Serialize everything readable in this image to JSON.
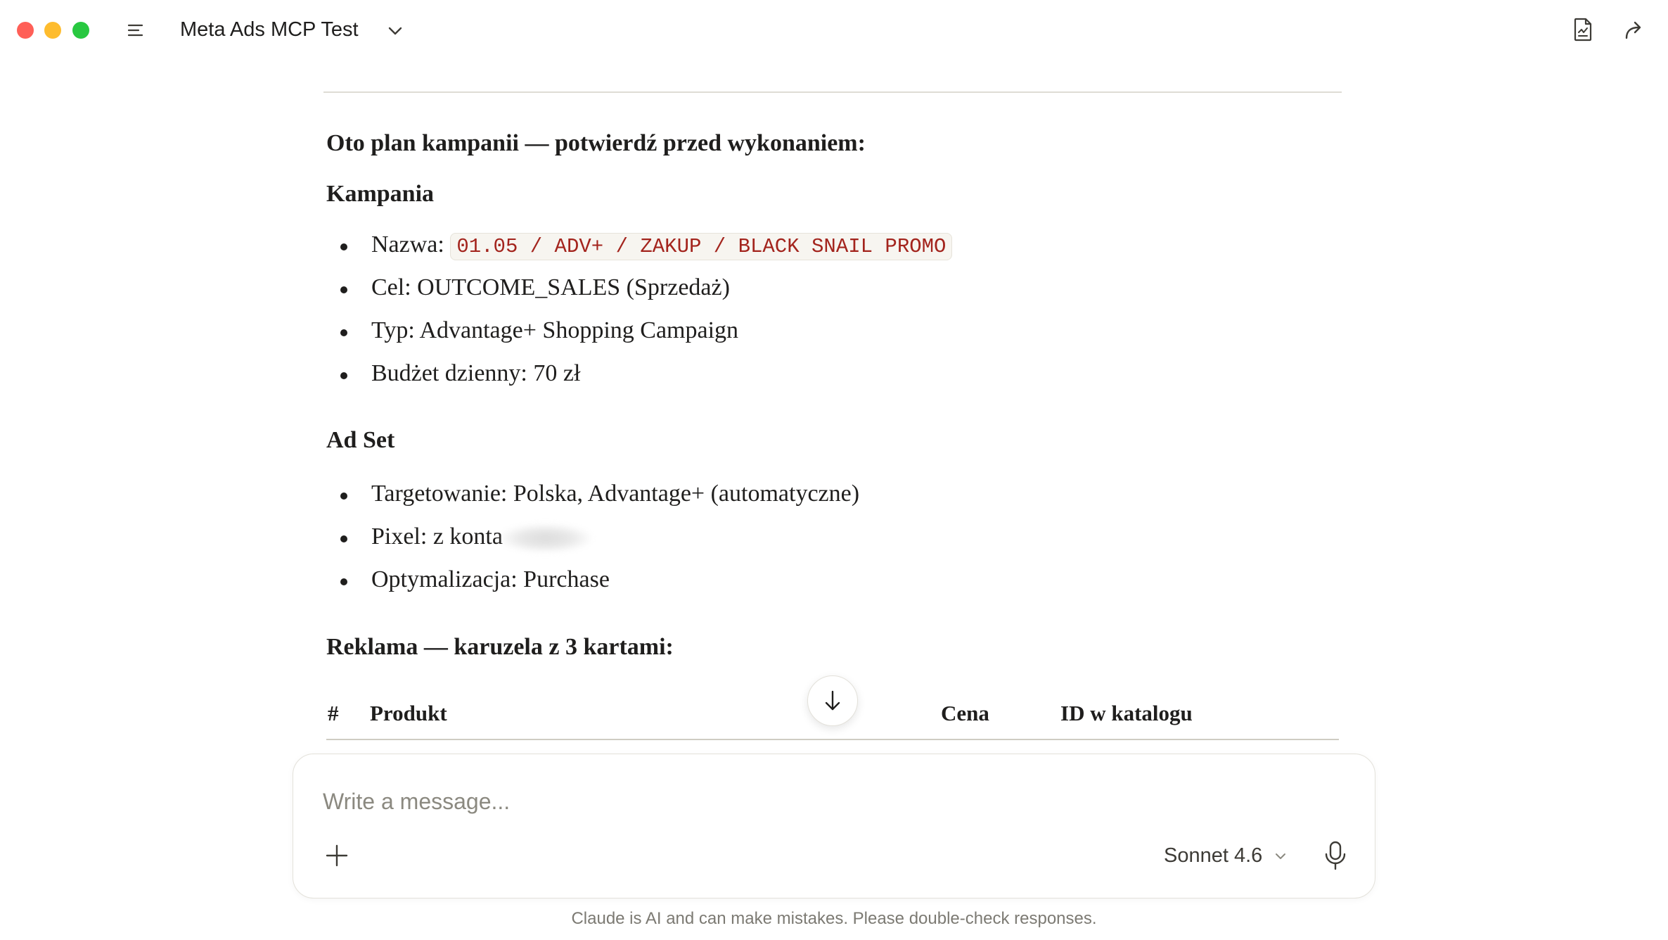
{
  "window": {
    "project_title": "Meta Ads MCP Test"
  },
  "message": {
    "intro_heading": "Oto plan kampanii — potwierdź przed wykonaniem:",
    "campaign": {
      "heading": "Kampania",
      "items": [
        {
          "label": "Nazwa: ",
          "code": "01.05 / ADV+ / ZAKUP / BLACK SNAIL PROMO"
        },
        {
          "label": "Cel: OUTCOME_SALES (Sprzedaż)"
        },
        {
          "label": "Typ: Advantage+ Shopping Campaign"
        },
        {
          "label": "Budżet dzienny: 70 zł"
        }
      ]
    },
    "adset": {
      "heading": "Ad Set",
      "items": [
        {
          "label": "Targetowanie: Polska, Advantage+ (automatyczne)"
        },
        {
          "label": "Pixel: z konta"
        },
        {
          "label": "Optymalizacja: Purchase"
        }
      ]
    },
    "ad": {
      "heading": "Reklama — karuzela z 3 kartami:",
      "table_headers": [
        "#",
        "Produkt",
        "Cena",
        "ID w katalogu"
      ]
    }
  },
  "composer": {
    "placeholder": "Write a message...",
    "model": "Sonnet 4.6"
  },
  "disclaimer": "Claude is AI and can make mistakes. Please double-check responses.",
  "colors": {
    "accent_code": "#a3241d",
    "traffic_red": "#ff5f57",
    "traffic_yellow": "#febc2e",
    "traffic_green": "#28c840"
  },
  "icons": [
    "sidebar-toggle-icon",
    "chevron-down-icon",
    "document-icon",
    "share-icon",
    "arrow-down-icon",
    "plus-icon",
    "microphone-icon"
  ]
}
